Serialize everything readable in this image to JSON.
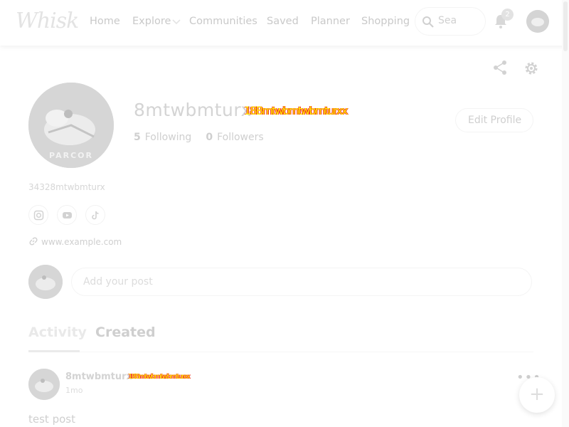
{
  "brand": {
    "logo_text": "Whisk"
  },
  "nav": {
    "home": "Home",
    "explore": "Explore",
    "communities": "Communities",
    "saved": "Saved",
    "planner": "Planner",
    "shopping": "Shopping"
  },
  "search": {
    "placeholder": "Sea"
  },
  "notifications": {
    "count": "2"
  },
  "profile": {
    "display_name": "8mtwbmturx",
    "name_overlay": "18Bmtwbmtwbmturxx",
    "following_count": "5",
    "following_label": "Following",
    "followers_count": "0",
    "followers_label": "Followers",
    "edit_label": "Edit Profile",
    "avatar_text": "PARCOR",
    "handle": "34328mtwbmturx",
    "website": "www.example.com"
  },
  "social_icons": [
    "instagram-icon",
    "youtube-icon",
    "tiktok-icon"
  ],
  "composer": {
    "placeholder": "Add your post"
  },
  "tabs": [
    {
      "label": "Activity",
      "active": true
    },
    {
      "label": "Created",
      "active": false
    }
  ],
  "post": {
    "author": "8mtwbmturx",
    "author_overlay": "18Bmtwbmtwbmturxx",
    "time": "1mo",
    "text": "test post",
    "menu": "•••"
  },
  "fab": {
    "label": "+"
  },
  "colors": {
    "overlay_text": "#ffee00",
    "overlay_outline": "#ee1d1d",
    "muted_text": "#cfcfcf"
  }
}
